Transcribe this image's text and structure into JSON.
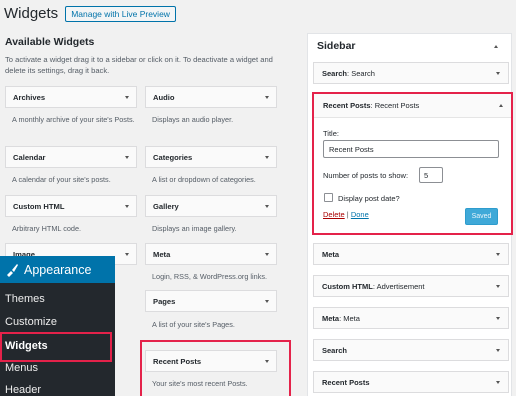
{
  "header": {
    "title": "Widgets",
    "preview_button": "Manage with Live Preview"
  },
  "available": {
    "title": "Available Widgets",
    "description": "To activate a widget drag it to a sidebar or click on it. To deactivate a widget and delete its settings, drag it back.",
    "widgets": [
      {
        "name": "Archives",
        "desc": "A monthly archive of your site's Posts."
      },
      {
        "name": "Audio",
        "desc": "Displays an audio player."
      },
      {
        "name": "Calendar",
        "desc": "A calendar of your site's posts."
      },
      {
        "name": "Categories",
        "desc": "A list or dropdown of categories."
      },
      {
        "name": "Custom HTML",
        "desc": "Arbitrary HTML code."
      },
      {
        "name": "Gallery",
        "desc": "Displays an image gallery."
      },
      {
        "name": "Image",
        "desc": ""
      },
      {
        "name": "Meta",
        "desc": "Login, RSS, & WordPress.org links."
      },
      {
        "name": "Pages",
        "desc": "A list of your site's Pages."
      },
      {
        "name": "Recent Posts",
        "desc": "Your site's most recent Posts."
      }
    ]
  },
  "sidebar": {
    "title": "Sidebar",
    "search_widget": {
      "type": "Search",
      "title": ": Search"
    },
    "recent_posts": {
      "type": "Recent Posts",
      "title": ": Recent Posts",
      "title_label": "Title:",
      "title_value": "Recent Posts",
      "num_label": "Number of posts to show:",
      "num_value": "5",
      "date_label": "Display post date?",
      "delete": "Delete",
      "separator": "|",
      "done": "Done",
      "save": "Saved"
    },
    "items": [
      {
        "type": "Meta",
        "title": ""
      },
      {
        "type": "Custom HTML",
        "title": ": Advertisement"
      },
      {
        "type": "Meta",
        "title": ": Meta"
      },
      {
        "type": "Search",
        "title": ""
      },
      {
        "type": "Recent Posts",
        "title": ""
      }
    ]
  },
  "admin_menu": {
    "section": "Appearance",
    "items": [
      "Themes",
      "Customize",
      "Widgets",
      "Menus",
      "Header"
    ]
  },
  "colors": {
    "accent": "#0073aa",
    "highlight": "#e4224a",
    "menu_bg": "#23282d"
  }
}
